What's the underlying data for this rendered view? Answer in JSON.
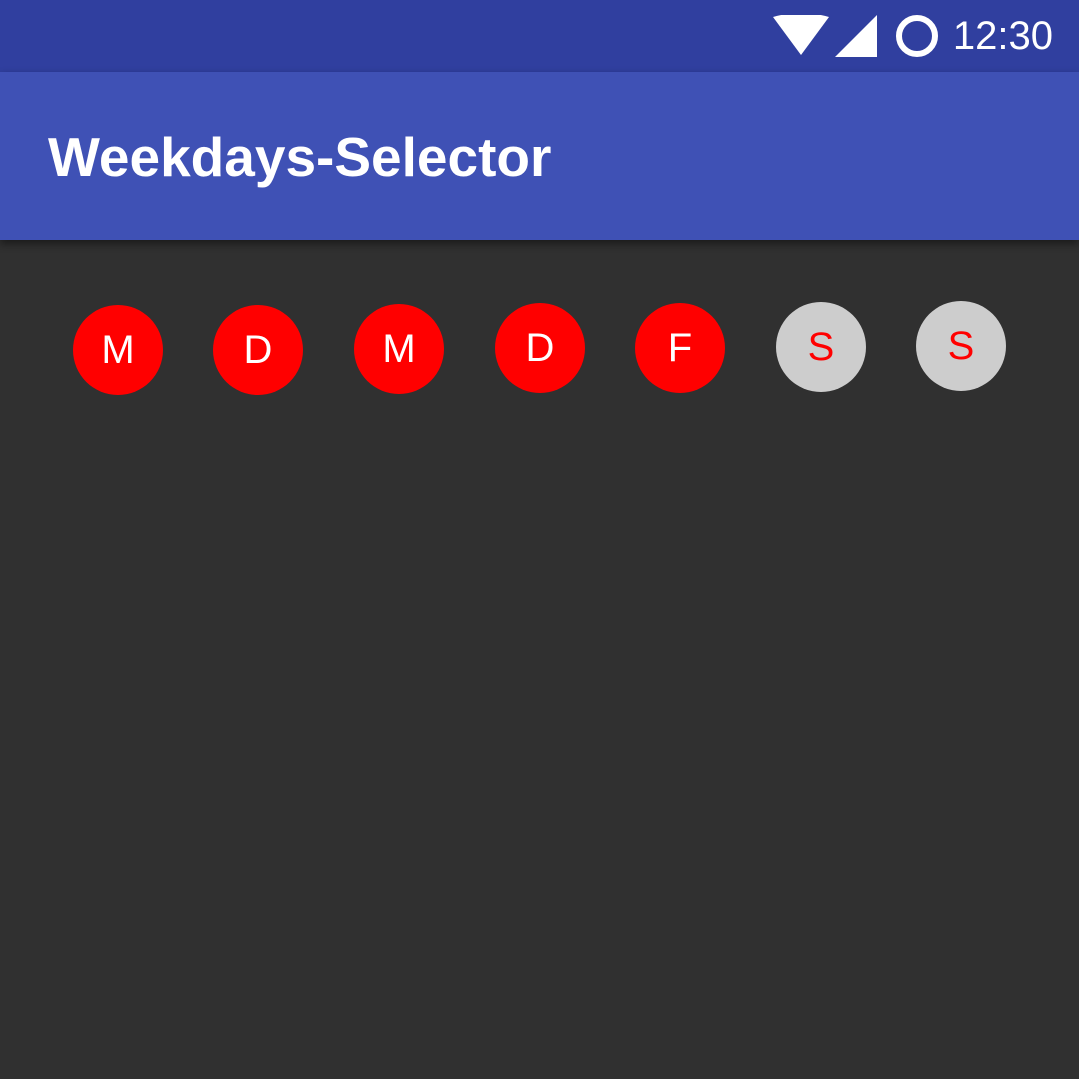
{
  "status_bar": {
    "time": "12:30",
    "icons": [
      "wifi-icon",
      "cell-signal-icon",
      "circle-icon"
    ],
    "background_color": "#303f9f"
  },
  "app_bar": {
    "title": "Weekdays-Selector",
    "background_color": "#3f51b5"
  },
  "content": {
    "background_color": "#303030"
  },
  "weekdays": [
    {
      "label": "M",
      "selected": true
    },
    {
      "label": "D",
      "selected": true
    },
    {
      "label": "M",
      "selected": true
    },
    {
      "label": "D",
      "selected": true
    },
    {
      "label": "F",
      "selected": true
    },
    {
      "label": "S",
      "selected": false
    },
    {
      "label": "S",
      "selected": false
    }
  ],
  "colors": {
    "selected_fill": "#ff0000",
    "selected_text": "#ffffff",
    "unselected_fill": "#cdcdcd",
    "unselected_text": "#ff0000"
  }
}
